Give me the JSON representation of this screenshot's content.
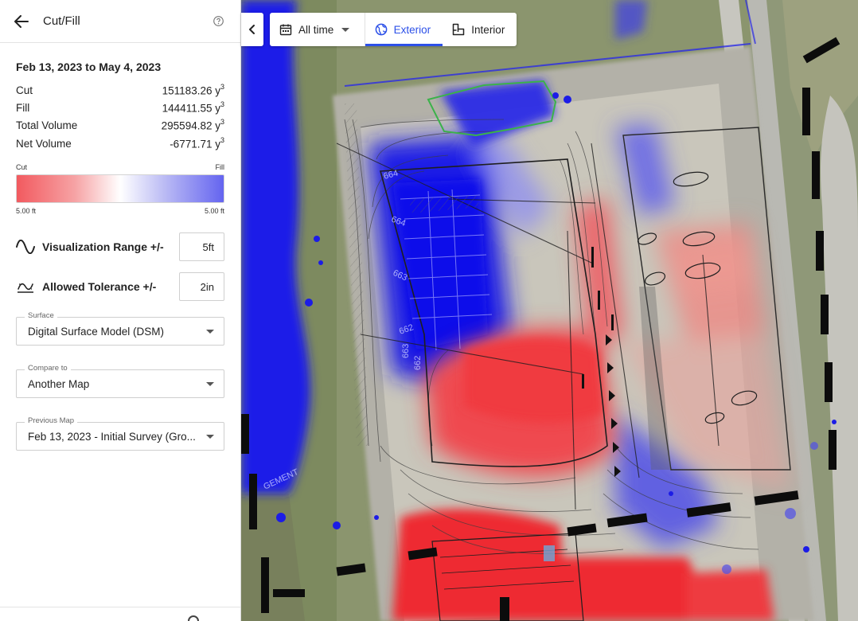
{
  "header": {
    "title": "Cut/Fill"
  },
  "summary": {
    "date_range": "Feb 13, 2023 to May 4, 2023",
    "stats": [
      {
        "label": "Cut",
        "value": "151183.26 y",
        "unit_exp": "3"
      },
      {
        "label": "Fill",
        "value": "144411.55 y",
        "unit_exp": "3"
      },
      {
        "label": "Total Volume",
        "value": "295594.82 y",
        "unit_exp": "3"
      },
      {
        "label": "Net Volume",
        "value": "-6771.71 y",
        "unit_exp": "3"
      }
    ]
  },
  "legend": {
    "left_label": "Cut",
    "right_label": "Fill",
    "left_value": "5.00 ft",
    "right_value": "5.00 ft",
    "cut_color": "#f25a5f",
    "fill_color": "#6464f0"
  },
  "controls": {
    "visualization_range": {
      "label": "Visualization Range +/-",
      "value": "5ft"
    },
    "allowed_tolerance": {
      "label": "Allowed Tolerance +/-",
      "value": "2in"
    },
    "surface": {
      "label": "Surface",
      "value": "Digital Surface Model (DSM)"
    },
    "compare_to": {
      "label": "Compare to",
      "value": "Another Map"
    },
    "previous_map": {
      "label": "Previous Map",
      "value": "Feb 13, 2023 - Initial Survey (Gro..."
    }
  },
  "toolbar": {
    "time_label": "All time",
    "exterior_label": "Exterior",
    "interior_label": "Interior",
    "active_tab": "Exterior",
    "accent_color": "#2c50e8"
  },
  "map": {
    "contour_labels": [
      "664",
      "664",
      "663",
      "662",
      "663",
      "662",
      "GEMENT"
    ]
  }
}
